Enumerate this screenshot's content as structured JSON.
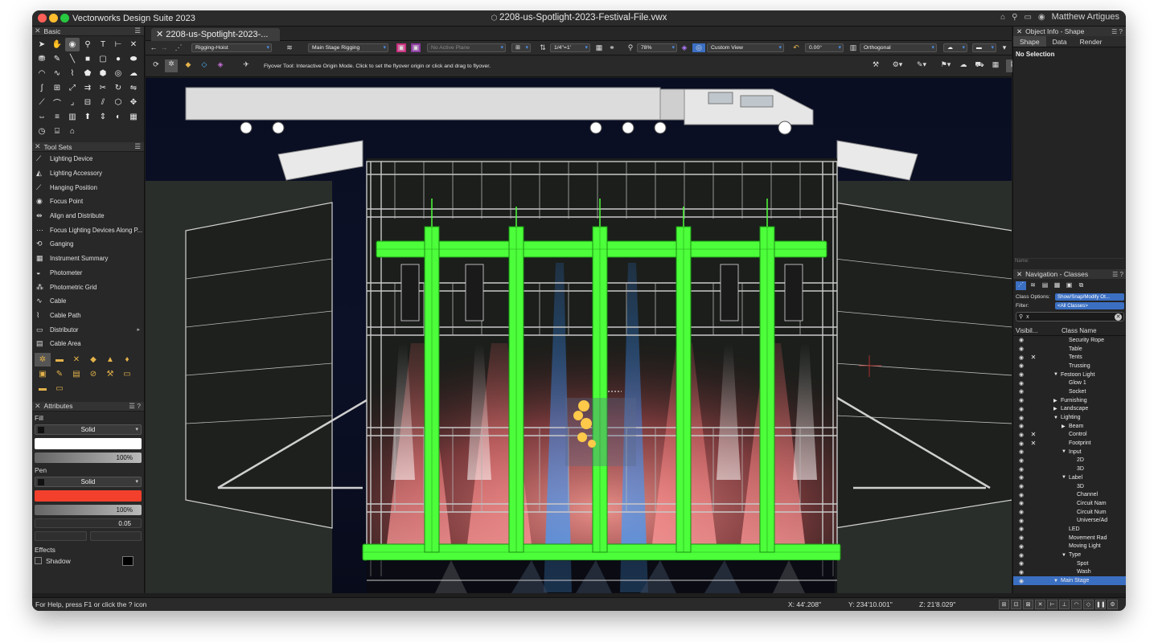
{
  "app": {
    "name": "Vectorworks Design Suite 2023",
    "document_title": "2208-us-Spotlight-2023-Festival-File.vwx",
    "user": "Matthew Artigues",
    "tab_label": "2208-us-Spotlight-2023-..."
  },
  "basic_palette": {
    "title": "Basic",
    "tools": [
      "arrow-icon",
      "hand-icon",
      "flyover-icon",
      "zoom-icon",
      "text-icon",
      "dimension-icon",
      "close-x-icon",
      "attribute-icon",
      "eyedropper-icon",
      "line-icon",
      "rectangle-icon",
      "rounded-rect-icon",
      "circle-icon",
      "oval-icon",
      "arc-icon",
      "freehand-icon",
      "polyline-icon",
      "polygon-icon",
      "regular-polygon-icon",
      "spiral-icon",
      "cloud-icon",
      "spline-icon",
      "grid-icon",
      "scale-icon",
      "offset-icon",
      "trim-icon",
      "rotate-icon",
      "mirror-icon",
      "connect-icon",
      "fillet-icon",
      "chamfer-icon",
      "clip-icon",
      "split-icon",
      "reshape-icon",
      "move-icon",
      "stretch-icon",
      "align-icon",
      "wall-icon",
      "extrude-icon",
      "push-pull-icon",
      "sweep-icon",
      "mesh-icon",
      "camera-icon",
      "stair-icon",
      "roof-icon"
    ]
  },
  "tool_sets": {
    "title": "Tool Sets",
    "items": [
      {
        "label": "Lighting Device",
        "icon": "lighting-device-icon"
      },
      {
        "label": "Lighting Accessory",
        "icon": "lighting-accessory-icon"
      },
      {
        "label": "Hanging Position",
        "icon": "hanging-position-icon"
      },
      {
        "label": "Focus Point",
        "icon": "focus-point-icon"
      },
      {
        "label": "Align and Distribute",
        "icon": "align-distribute-icon"
      },
      {
        "label": "Focus Lighting Devices Along P...",
        "icon": "focus-along-path-icon"
      },
      {
        "label": "Ganging",
        "icon": "ganging-icon"
      },
      {
        "label": "Instrument Summary",
        "icon": "instrument-summary-icon"
      },
      {
        "label": "Photometer",
        "icon": "photometer-icon"
      },
      {
        "label": "Photometric Grid",
        "icon": "photometric-grid-icon"
      },
      {
        "label": "Cable",
        "icon": "cable-icon"
      },
      {
        "label": "Cable Path",
        "icon": "cable-path-icon"
      },
      {
        "label": "Distributor",
        "icon": "distributor-icon"
      },
      {
        "label": "Cable Area",
        "icon": "cable-area-icon"
      }
    ],
    "set_icons": [
      "spotlight-set-icon",
      "truss-set-icon",
      "rigging-set-icon",
      "cube-set-icon",
      "landscape-set-icon",
      "light-set-icon",
      "box-set-icon",
      "pen-set-icon",
      "furniture-set-icon",
      "link-set-icon",
      "tools-set-icon",
      "storage-set-icon",
      "crate-set-icon",
      "tray-set-icon"
    ]
  },
  "attributes": {
    "title": "Attributes",
    "fill_label": "Fill",
    "fill_style": "Solid",
    "fill_color": "#ffffff",
    "fill_opacity": "100%",
    "pen_label": "Pen",
    "pen_style": "Solid",
    "pen_color": "#f2402c",
    "pen_opacity": "100%",
    "pen_weight": "0.05",
    "effects_label": "Effects",
    "shadow_label": "Shadow"
  },
  "view_bar": {
    "layer": "Rigging-Hoist",
    "class": "Main Stage Rigging",
    "plane": "No Active Plane",
    "scale": "1/4\"=1'",
    "zoom": "78%",
    "view": "Custom View",
    "angle": "0.00°",
    "projection": "Orthogonal"
  },
  "mode_bar": {
    "hint": "Flyover Tool: Interactive Origin Mode. Click to set the flyover origin or click and drag to flyover."
  },
  "object_info": {
    "title": "Object Info - Shape",
    "tabs": [
      "Shape",
      "Data",
      "Render"
    ],
    "active_tab": "Shape",
    "selection": "No Selection",
    "name_label": "Name:"
  },
  "navigation": {
    "title": "Navigation - Classes",
    "class_options_label": "Class Options:",
    "class_options_value": "Show/Snap/Modify Ot...",
    "filter_label": "Filter:",
    "filter_value": "<All Classes>",
    "search_value": "x",
    "col_visibility": "Visibil...",
    "col_class_name": "Class Name",
    "rows": [
      {
        "name": "Security Rope",
        "indent": 3,
        "mark": "",
        "exp": ""
      },
      {
        "name": "Table",
        "indent": 3,
        "mark": "",
        "exp": ""
      },
      {
        "name": "Tents",
        "indent": 3,
        "mark": "✕",
        "exp": ""
      },
      {
        "name": "Trussing",
        "indent": 3,
        "mark": "",
        "exp": ""
      },
      {
        "name": "Festoon Light",
        "indent": 2,
        "mark": "",
        "exp": "▼"
      },
      {
        "name": "Glow 1",
        "indent": 3,
        "mark": "",
        "exp": ""
      },
      {
        "name": "Socket",
        "indent": 3,
        "mark": "",
        "exp": ""
      },
      {
        "name": "Furnishing",
        "indent": 2,
        "mark": "",
        "exp": "▶"
      },
      {
        "name": "Landscape",
        "indent": 2,
        "mark": "",
        "exp": "▶"
      },
      {
        "name": "Lighting",
        "indent": 2,
        "mark": "",
        "exp": "▼"
      },
      {
        "name": "Beam",
        "indent": 3,
        "mark": "",
        "exp": "▶"
      },
      {
        "name": "Control",
        "indent": 3,
        "mark": "✕",
        "exp": ""
      },
      {
        "name": "Footprint",
        "indent": 3,
        "mark": "✕",
        "exp": ""
      },
      {
        "name": "Input",
        "indent": 3,
        "mark": "",
        "exp": "▼"
      },
      {
        "name": "2D",
        "indent": 4,
        "mark": "",
        "exp": ""
      },
      {
        "name": "3D",
        "indent": 4,
        "mark": "",
        "exp": ""
      },
      {
        "name": "Label",
        "indent": 3,
        "mark": "",
        "exp": "▼"
      },
      {
        "name": "3D",
        "indent": 4,
        "mark": "",
        "exp": ""
      },
      {
        "name": "Channel",
        "indent": 4,
        "mark": "",
        "exp": ""
      },
      {
        "name": "Circuit Nam",
        "indent": 4,
        "mark": "",
        "exp": ""
      },
      {
        "name": "Circuit Num",
        "indent": 4,
        "mark": "",
        "exp": ""
      },
      {
        "name": "Universe/Ad",
        "indent": 4,
        "mark": "",
        "exp": ""
      },
      {
        "name": "LED",
        "indent": 3,
        "mark": "",
        "exp": ""
      },
      {
        "name": "Movement Rad",
        "indent": 3,
        "mark": "",
        "exp": ""
      },
      {
        "name": "Moving Light",
        "indent": 3,
        "mark": "",
        "exp": ""
      },
      {
        "name": "Type",
        "indent": 3,
        "mark": "",
        "exp": "▼"
      },
      {
        "name": "Spot",
        "indent": 4,
        "mark": "",
        "exp": ""
      },
      {
        "name": "Wash",
        "indent": 4,
        "mark": "",
        "exp": ""
      },
      {
        "name": "Main Stage",
        "indent": 2,
        "mark": "",
        "exp": "▼",
        "highlight": true
      }
    ]
  },
  "status_bar": {
    "help": "For Help, press F1 or click the ? icon",
    "x": "X: 44'.208\"",
    "y": "Y: 234'10.001\"",
    "z": "Z: 21'8.029\""
  },
  "colors": {
    "truss_green": "#4cff3a",
    "canvas_bg": "#0c1024",
    "accent_blue": "#3b6fc2"
  }
}
